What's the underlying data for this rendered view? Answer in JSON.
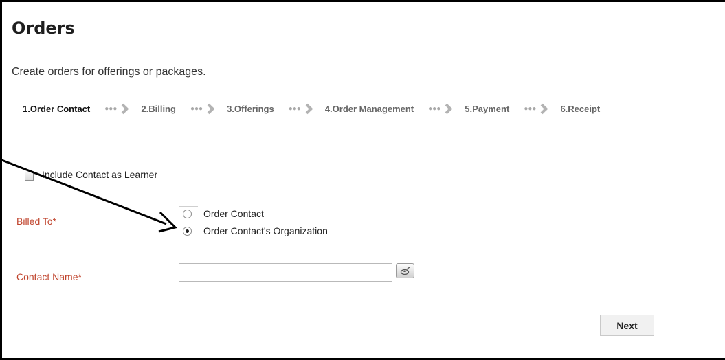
{
  "page": {
    "title": "Orders",
    "subtitle": "Create orders for offerings or packages."
  },
  "wizard": {
    "steps": [
      {
        "label": "1.Order Contact",
        "active": true
      },
      {
        "label": "2.Billing",
        "active": false
      },
      {
        "label": "3.Offerings",
        "active": false
      },
      {
        "label": "4.Order Management",
        "active": false
      },
      {
        "label": "5.Payment",
        "active": false
      },
      {
        "label": "6.Receipt",
        "active": false
      }
    ],
    "separator_icon": "chevron-right-icon"
  },
  "form": {
    "include_learner": {
      "label": "Include Contact as Learner",
      "checked": false
    },
    "billed_to": {
      "label": "Billed To*",
      "options": [
        {
          "label": "Order Contact",
          "selected": false
        },
        {
          "label": "Order Contact's Organization",
          "selected": true
        }
      ]
    },
    "contact_name": {
      "label": "Contact Name*",
      "value": "",
      "lookup_icon": "lookup-icon"
    }
  },
  "actions": {
    "next_label": "Next"
  },
  "colors": {
    "required_label": "#c0442d",
    "annotation_arrow": "#000000"
  }
}
